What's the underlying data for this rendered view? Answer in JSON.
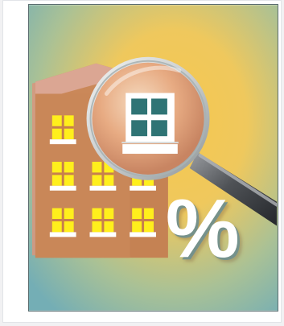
{
  "illustration": {
    "subject": "building-with-magnifying-glass-and-percent",
    "percent_symbol": "%",
    "colors": {
      "background_center": "#f2c04a",
      "background_edge": "#7fb7bb",
      "building": "#c98758",
      "roof": "#d9a392",
      "window_light": "#ffef1c",
      "glass_tint": "#2f7475",
      "percent": "#ffffff"
    }
  }
}
